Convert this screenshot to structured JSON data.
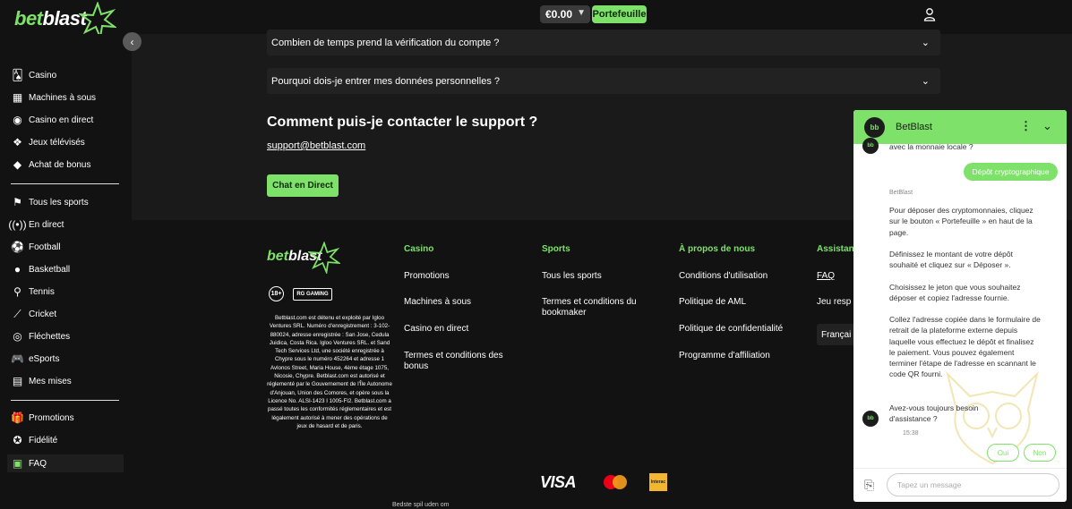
{
  "header": {
    "logo_bet": "bet",
    "logo_blast": "blast",
    "balance": "€0.00",
    "wallet_label": "Portefeuille"
  },
  "sidebar": {
    "group1": [
      {
        "label": "Casino",
        "icon": "cards-icon"
      },
      {
        "label": "Machines à sous",
        "icon": "slot-machine-icon"
      },
      {
        "label": "Casino en direct",
        "icon": "live-casino-icon"
      },
      {
        "label": "Jeux télévisés",
        "icon": "tv-icon"
      },
      {
        "label": "Achat de bonus",
        "icon": "diamond-icon"
      }
    ],
    "group2": [
      {
        "label": "Tous les sports",
        "icon": "sports-icon"
      },
      {
        "label": "En direct",
        "icon": "live-icon"
      },
      {
        "label": "Football",
        "icon": "football-icon"
      },
      {
        "label": "Basketball",
        "icon": "basketball-icon"
      },
      {
        "label": "Tennis",
        "icon": "tennis-icon"
      },
      {
        "label": "Cricket",
        "icon": "cricket-icon"
      },
      {
        "label": "Fléchettes",
        "icon": "darts-icon"
      },
      {
        "label": "eSports",
        "icon": "gamepad-icon"
      },
      {
        "label": "Mes mises",
        "icon": "bets-icon"
      }
    ],
    "group3": [
      {
        "label": "Promotions",
        "icon": "gift-icon"
      },
      {
        "label": "Fidélité",
        "icon": "star-icon"
      },
      {
        "label": "FAQ",
        "icon": "faq-icon"
      }
    ]
  },
  "main": {
    "faq_items": [
      "Combien de temps prend la vérification du compte ?",
      "Pourquoi dois-je entrer mes données personnelles ?"
    ],
    "contact_title": "Comment puis-je contacter le support ?",
    "support_email": "support@betblast.com",
    "chat_button": "Chat en Direct"
  },
  "footer": {
    "logo_bet": "bet",
    "logo_blast": "blast",
    "age_badge": "18+",
    "rg_badge": "RG GAMING",
    "legal_text": "Betblast.com est détenu et exploité par Igloo Ventures SRL. Numéro d'enregistrement : 3-102-880024, adresse enregistrée : San Jose, Cedula Juidica, Costa Rica. Igloo Ventures SRL. et Sand Tech Services Ltd, une société enregistrée à Chypre sous le numéro 452264 et adresse 1 Avlonos Street, Maria House, 4ème étage 1075, Nicosie, Chypre. Betblast.com est autorisé et réglementé par le Gouvernement de l'Île Autonome d'Anjouan, Union des Comores, et opère sous la Licence No. ALSI-1423 I 1005-FI2. Betblast.com a passé toutes les conformités réglementaires et est légalement autorisé à mener des opérations de jeux de hasard et de paris.",
    "columns": [
      {
        "heading": "Casino",
        "links": [
          "Promotions",
          "Machines à sous",
          "Casino en direct",
          "Termes et conditions des bonus"
        ]
      },
      {
        "heading": "Sports",
        "links": [
          "Tous les sports",
          "Termes et conditions du bookmaker"
        ]
      },
      {
        "heading": "À propos de nous",
        "links": [
          "Conditions d'utilisation",
          "Politique de AML",
          "Politique de confidentialité",
          "Programme d'affiliation"
        ]
      },
      {
        "heading": "Assistan",
        "links": [
          "FAQ",
          "Jeu resp"
        ]
      }
    ],
    "language": "Françai",
    "payments": {
      "visa": "VISA",
      "interac": "Interac"
    },
    "bottom_text": "Bedste spil uden om"
  },
  "chat": {
    "title": "BetBlast",
    "avatar": "bb",
    "cut_text": "avec la monnaie locale ?",
    "user_reply": "Dépôt cryptographique",
    "bot_label": "BetBlast",
    "bot_paragraphs": [
      "Pour déposer des cryptomonnaies, cliquez sur le bouton « Portefeuille » en haut de la page.",
      "Définissez le montant de votre dépôt souhaité et cliquez sur « Déposer ».",
      "Choisissez le jeton que vous souhaitez déposer et copiez l'adresse fournie.",
      "Collez l'adresse copiée dans le formulaire de retrait de la plateforme externe depuis laquelle vous effectuez le dépôt et finalisez le paiement. Vous pouvez également terminer l'étape de l'adresse en scannant le code QR fourni."
    ],
    "question": "Avez-vous toujours besoin d'assistance ?",
    "time": "15:38",
    "options": [
      "Oui",
      "Non"
    ],
    "input_placeholder": "Tapez un message"
  },
  "colors": {
    "accent": "#7ee26a",
    "background": "#121212",
    "panel": "#1a1a1a"
  }
}
